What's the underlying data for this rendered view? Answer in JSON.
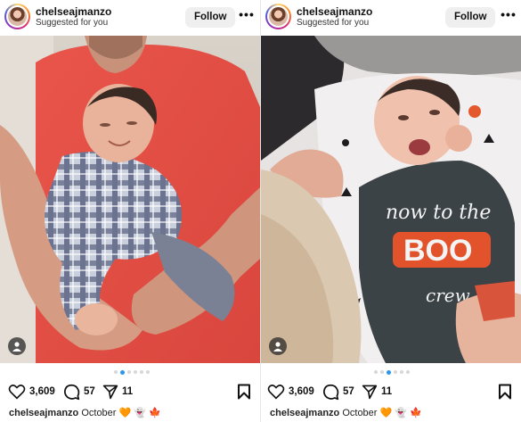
{
  "colors": {
    "accent_blue": "#2a96f0",
    "follow_bg": "#efefef",
    "dot_inactive": "#d7d7d7"
  },
  "posts": [
    {
      "username": "chelseajmanzo",
      "subtitle": "Suggested for you",
      "follow_label": "Follow",
      "more_label": "•••",
      "likes": "3,609",
      "comments": "57",
      "shares": "11",
      "caption_user": "chelseajmanzo",
      "caption_text": "October 🧡 👻 🍁",
      "carousel_active_index": 1,
      "carousel_count": 6,
      "icons": [
        "heart-icon",
        "comment-icon",
        "share-icon",
        "bookmark-icon",
        "user-tag-icon"
      ]
    },
    {
      "username": "chelseajmanzo",
      "subtitle": "Suggested for you",
      "follow_label": "Follow",
      "more_label": "•••",
      "likes": "3,609",
      "comments": "57",
      "shares": "11",
      "caption_user": "chelseajmanzo",
      "caption_text": "October 🧡 👻 🍁",
      "carousel_active_index": 2,
      "carousel_count": 6,
      "icons": [
        "heart-icon",
        "comment-icon",
        "share-icon",
        "bookmark-icon",
        "user-tag-icon"
      ]
    }
  ],
  "photo_right": {
    "shirt_text_line1": "now to the",
    "shirt_text_line2": "BOO",
    "shirt_text_line3": "crew"
  }
}
